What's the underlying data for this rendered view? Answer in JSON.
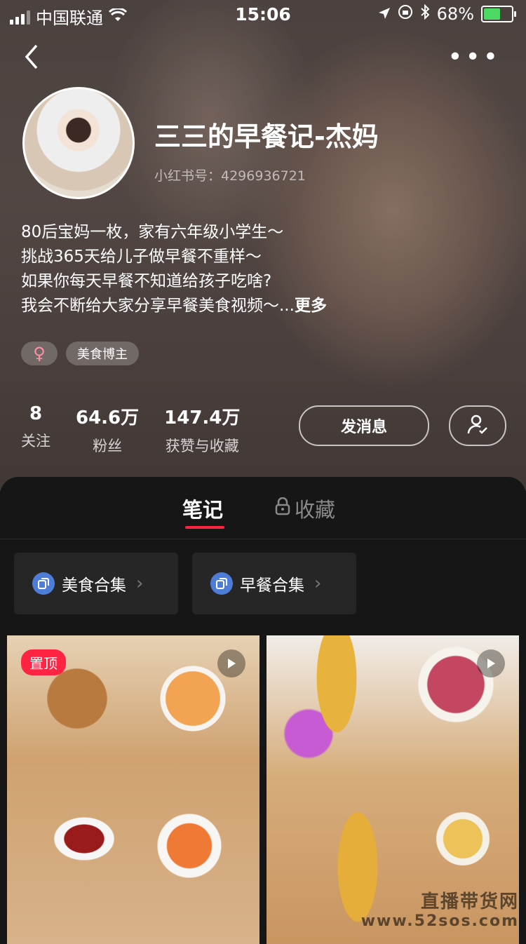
{
  "status_bar": {
    "carrier": "中国联通",
    "time": "15:06",
    "battery": "68%",
    "battery_level": 0.68
  },
  "profile": {
    "name": "三三的早餐记-杰妈",
    "red_id": "小红书号：4296936721",
    "bio": [
      "80后宝妈一枚，家有六年级小学生～",
      "挑战365天给儿子做早餐不重样～",
      "如果你每天早餐不知道给孩子吃啥?",
      "我会不断给大家分享早餐美食视频～..."
    ],
    "more": "更多",
    "gender_symbol": "♀",
    "tag": "美食博主"
  },
  "stats": [
    {
      "value": "8",
      "label": "关注"
    },
    {
      "value": "64.6万",
      "label": "粉丝"
    },
    {
      "value": "147.4万",
      "label": "获赞与收藏"
    }
  ],
  "actions": {
    "message": "发消息"
  },
  "tabs": {
    "notes": "笔记",
    "favorites": "收藏"
  },
  "collections": [
    "美食合集",
    "早餐合集"
  ],
  "notes": [
    {
      "badge": "置顶"
    }
  ],
  "watermark": {
    "line1": "直播带货网",
    "line2": "www.52sos.com"
  },
  "colors": {
    "accent": "#ff2442",
    "collection_icon": "#4e7dd8"
  }
}
